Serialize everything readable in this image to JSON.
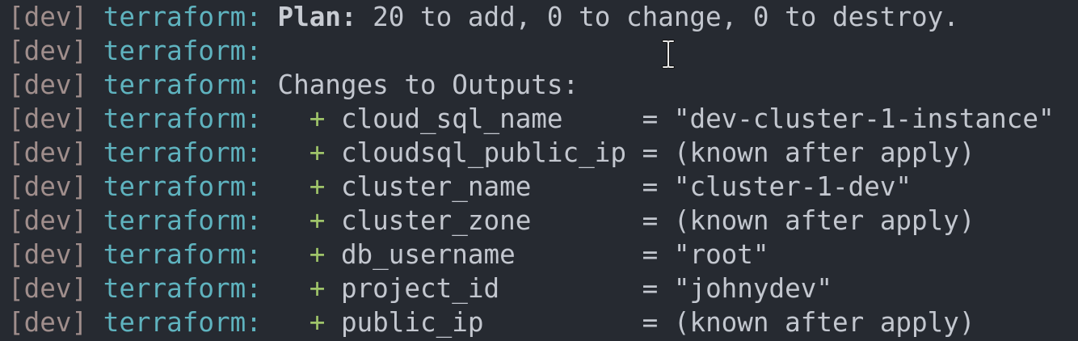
{
  "terminal": {
    "prefix_env": "[dev]",
    "prefix_tool": "terraform:",
    "plan_label": "Plan:",
    "plan_summary": " 20 to add, 0 to change, 0 to destroy.",
    "outputs_heading": "Changes to Outputs:",
    "outputs": [
      {
        "sign": "+",
        "name": "cloud_sql_name     ",
        "value": "= \"dev-cluster-1-instance\""
      },
      {
        "sign": "+",
        "name": "cloudsql_public_ip ",
        "value": "= (known after apply)"
      },
      {
        "sign": "+",
        "name": "cluster_name       ",
        "value": "= \"cluster-1-dev\""
      },
      {
        "sign": "+",
        "name": "cluster_zone       ",
        "value": "= (known after apply)"
      },
      {
        "sign": "+",
        "name": "db_username        ",
        "value": "= \"root\""
      },
      {
        "sign": "+",
        "name": "project_id         ",
        "value": "= \"johnydev\""
      },
      {
        "sign": "+",
        "name": "public_ip          ",
        "value": "= (known after apply)"
      }
    ]
  },
  "cursor": {
    "icon": "text-cursor-icon",
    "color": "#e8e8e8"
  }
}
